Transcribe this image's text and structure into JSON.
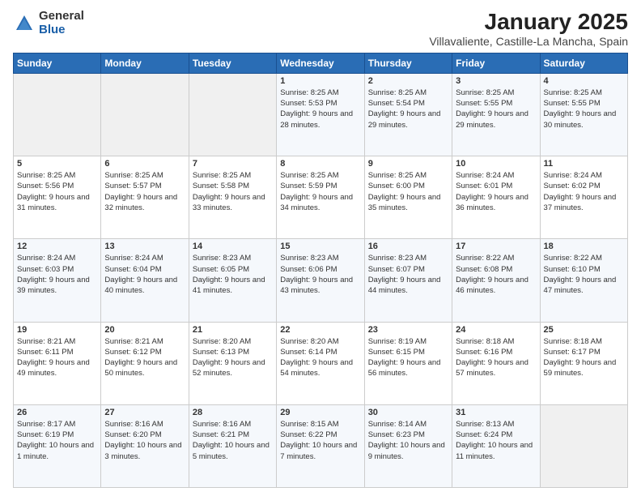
{
  "logo": {
    "general": "General",
    "blue": "Blue"
  },
  "title": "January 2025",
  "subtitle": "Villavaliente, Castille-La Mancha, Spain",
  "days": [
    "Sunday",
    "Monday",
    "Tuesday",
    "Wednesday",
    "Thursday",
    "Friday",
    "Saturday"
  ],
  "weeks": [
    [
      {
        "num": "",
        "sunrise": "",
        "sunset": "",
        "daylight": ""
      },
      {
        "num": "",
        "sunrise": "",
        "sunset": "",
        "daylight": ""
      },
      {
        "num": "",
        "sunrise": "",
        "sunset": "",
        "daylight": ""
      },
      {
        "num": "1",
        "sunrise": "Sunrise: 8:25 AM",
        "sunset": "Sunset: 5:53 PM",
        "daylight": "Daylight: 9 hours and 28 minutes."
      },
      {
        "num": "2",
        "sunrise": "Sunrise: 8:25 AM",
        "sunset": "Sunset: 5:54 PM",
        "daylight": "Daylight: 9 hours and 29 minutes."
      },
      {
        "num": "3",
        "sunrise": "Sunrise: 8:25 AM",
        "sunset": "Sunset: 5:55 PM",
        "daylight": "Daylight: 9 hours and 29 minutes."
      },
      {
        "num": "4",
        "sunrise": "Sunrise: 8:25 AM",
        "sunset": "Sunset: 5:55 PM",
        "daylight": "Daylight: 9 hours and 30 minutes."
      }
    ],
    [
      {
        "num": "5",
        "sunrise": "Sunrise: 8:25 AM",
        "sunset": "Sunset: 5:56 PM",
        "daylight": "Daylight: 9 hours and 31 minutes."
      },
      {
        "num": "6",
        "sunrise": "Sunrise: 8:25 AM",
        "sunset": "Sunset: 5:57 PM",
        "daylight": "Daylight: 9 hours and 32 minutes."
      },
      {
        "num": "7",
        "sunrise": "Sunrise: 8:25 AM",
        "sunset": "Sunset: 5:58 PM",
        "daylight": "Daylight: 9 hours and 33 minutes."
      },
      {
        "num": "8",
        "sunrise": "Sunrise: 8:25 AM",
        "sunset": "Sunset: 5:59 PM",
        "daylight": "Daylight: 9 hours and 34 minutes."
      },
      {
        "num": "9",
        "sunrise": "Sunrise: 8:25 AM",
        "sunset": "Sunset: 6:00 PM",
        "daylight": "Daylight: 9 hours and 35 minutes."
      },
      {
        "num": "10",
        "sunrise": "Sunrise: 8:24 AM",
        "sunset": "Sunset: 6:01 PM",
        "daylight": "Daylight: 9 hours and 36 minutes."
      },
      {
        "num": "11",
        "sunrise": "Sunrise: 8:24 AM",
        "sunset": "Sunset: 6:02 PM",
        "daylight": "Daylight: 9 hours and 37 minutes."
      }
    ],
    [
      {
        "num": "12",
        "sunrise": "Sunrise: 8:24 AM",
        "sunset": "Sunset: 6:03 PM",
        "daylight": "Daylight: 9 hours and 39 minutes."
      },
      {
        "num": "13",
        "sunrise": "Sunrise: 8:24 AM",
        "sunset": "Sunset: 6:04 PM",
        "daylight": "Daylight: 9 hours and 40 minutes."
      },
      {
        "num": "14",
        "sunrise": "Sunrise: 8:23 AM",
        "sunset": "Sunset: 6:05 PM",
        "daylight": "Daylight: 9 hours and 41 minutes."
      },
      {
        "num": "15",
        "sunrise": "Sunrise: 8:23 AM",
        "sunset": "Sunset: 6:06 PM",
        "daylight": "Daylight: 9 hours and 43 minutes."
      },
      {
        "num": "16",
        "sunrise": "Sunrise: 8:23 AM",
        "sunset": "Sunset: 6:07 PM",
        "daylight": "Daylight: 9 hours and 44 minutes."
      },
      {
        "num": "17",
        "sunrise": "Sunrise: 8:22 AM",
        "sunset": "Sunset: 6:08 PM",
        "daylight": "Daylight: 9 hours and 46 minutes."
      },
      {
        "num": "18",
        "sunrise": "Sunrise: 8:22 AM",
        "sunset": "Sunset: 6:10 PM",
        "daylight": "Daylight: 9 hours and 47 minutes."
      }
    ],
    [
      {
        "num": "19",
        "sunrise": "Sunrise: 8:21 AM",
        "sunset": "Sunset: 6:11 PM",
        "daylight": "Daylight: 9 hours and 49 minutes."
      },
      {
        "num": "20",
        "sunrise": "Sunrise: 8:21 AM",
        "sunset": "Sunset: 6:12 PM",
        "daylight": "Daylight: 9 hours and 50 minutes."
      },
      {
        "num": "21",
        "sunrise": "Sunrise: 8:20 AM",
        "sunset": "Sunset: 6:13 PM",
        "daylight": "Daylight: 9 hours and 52 minutes."
      },
      {
        "num": "22",
        "sunrise": "Sunrise: 8:20 AM",
        "sunset": "Sunset: 6:14 PM",
        "daylight": "Daylight: 9 hours and 54 minutes."
      },
      {
        "num": "23",
        "sunrise": "Sunrise: 8:19 AM",
        "sunset": "Sunset: 6:15 PM",
        "daylight": "Daylight: 9 hours and 56 minutes."
      },
      {
        "num": "24",
        "sunrise": "Sunrise: 8:18 AM",
        "sunset": "Sunset: 6:16 PM",
        "daylight": "Daylight: 9 hours and 57 minutes."
      },
      {
        "num": "25",
        "sunrise": "Sunrise: 8:18 AM",
        "sunset": "Sunset: 6:17 PM",
        "daylight": "Daylight: 9 hours and 59 minutes."
      }
    ],
    [
      {
        "num": "26",
        "sunrise": "Sunrise: 8:17 AM",
        "sunset": "Sunset: 6:19 PM",
        "daylight": "Daylight: 10 hours and 1 minute."
      },
      {
        "num": "27",
        "sunrise": "Sunrise: 8:16 AM",
        "sunset": "Sunset: 6:20 PM",
        "daylight": "Daylight: 10 hours and 3 minutes."
      },
      {
        "num": "28",
        "sunrise": "Sunrise: 8:16 AM",
        "sunset": "Sunset: 6:21 PM",
        "daylight": "Daylight: 10 hours and 5 minutes."
      },
      {
        "num": "29",
        "sunrise": "Sunrise: 8:15 AM",
        "sunset": "Sunset: 6:22 PM",
        "daylight": "Daylight: 10 hours and 7 minutes."
      },
      {
        "num": "30",
        "sunrise": "Sunrise: 8:14 AM",
        "sunset": "Sunset: 6:23 PM",
        "daylight": "Daylight: 10 hours and 9 minutes."
      },
      {
        "num": "31",
        "sunrise": "Sunrise: 8:13 AM",
        "sunset": "Sunset: 6:24 PM",
        "daylight": "Daylight: 10 hours and 11 minutes."
      },
      {
        "num": "",
        "sunrise": "",
        "sunset": "",
        "daylight": ""
      }
    ]
  ]
}
